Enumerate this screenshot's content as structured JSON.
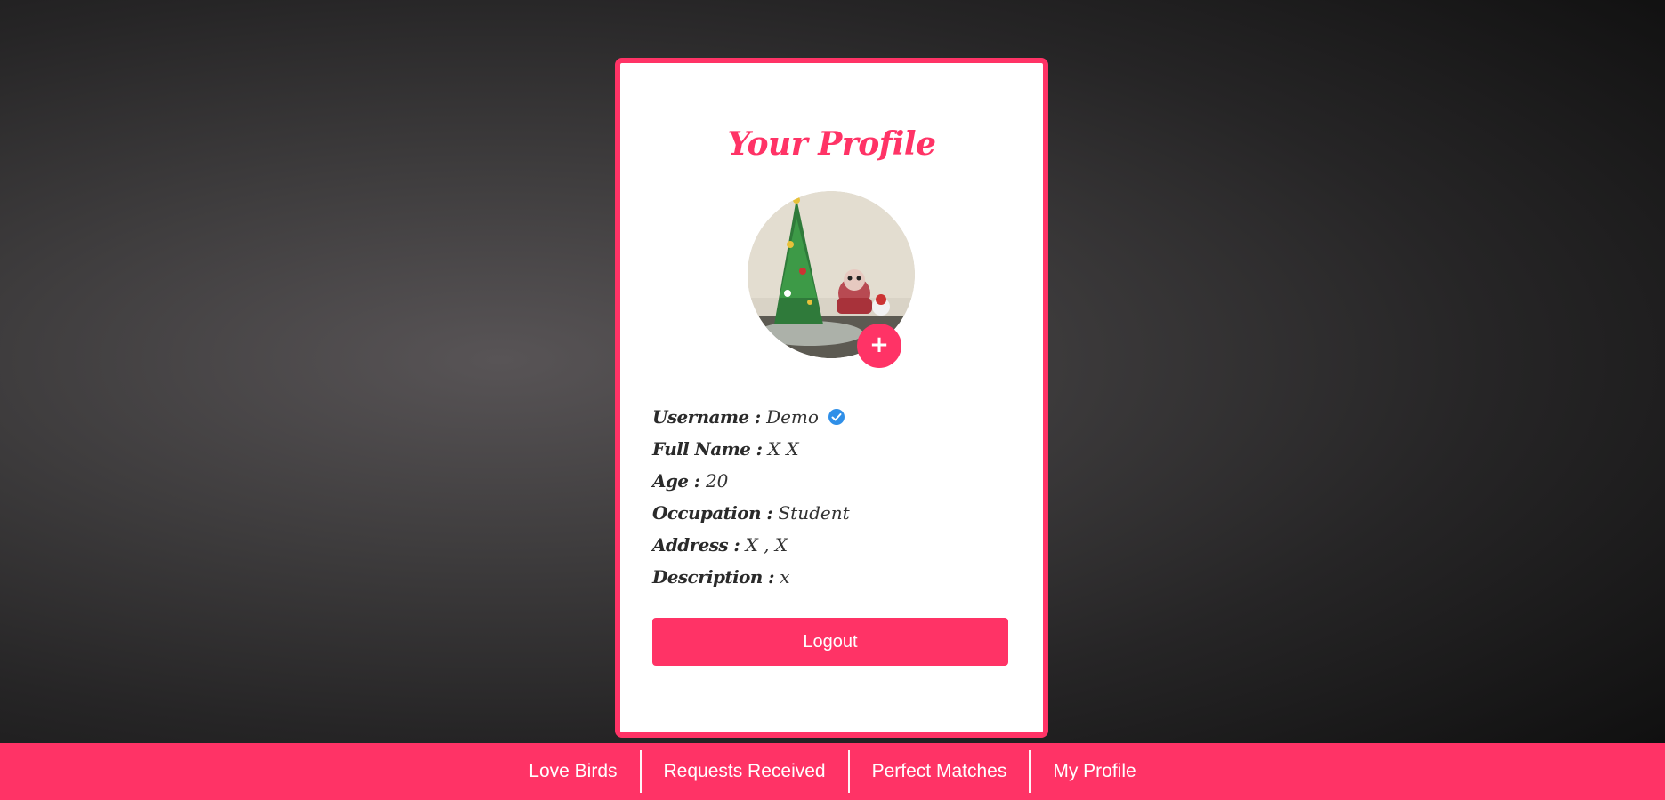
{
  "profile": {
    "title": "Your Profile",
    "add_photo_icon": "plus-icon",
    "avatar_alt": "Christmas tree with ornaments",
    "fields": [
      {
        "label": "Username :",
        "value": "Demo"
      },
      {
        "label": "Full Name :",
        "value": "X X"
      },
      {
        "label": "Age :",
        "value": "20"
      },
      {
        "label": "Occupation :",
        "value": "Student"
      },
      {
        "label": "Address :",
        "value": "X , X"
      },
      {
        "label": "Description :",
        "value": "x"
      }
    ],
    "verified_icon": "verified-badge-icon",
    "logout_label": "Logout"
  },
  "nav": {
    "items": [
      "Love Birds",
      "Requests Received",
      "Perfect Matches",
      "My Profile"
    ]
  },
  "colors": {
    "accent": "#ff3366",
    "verified": "#2f8fe8"
  }
}
